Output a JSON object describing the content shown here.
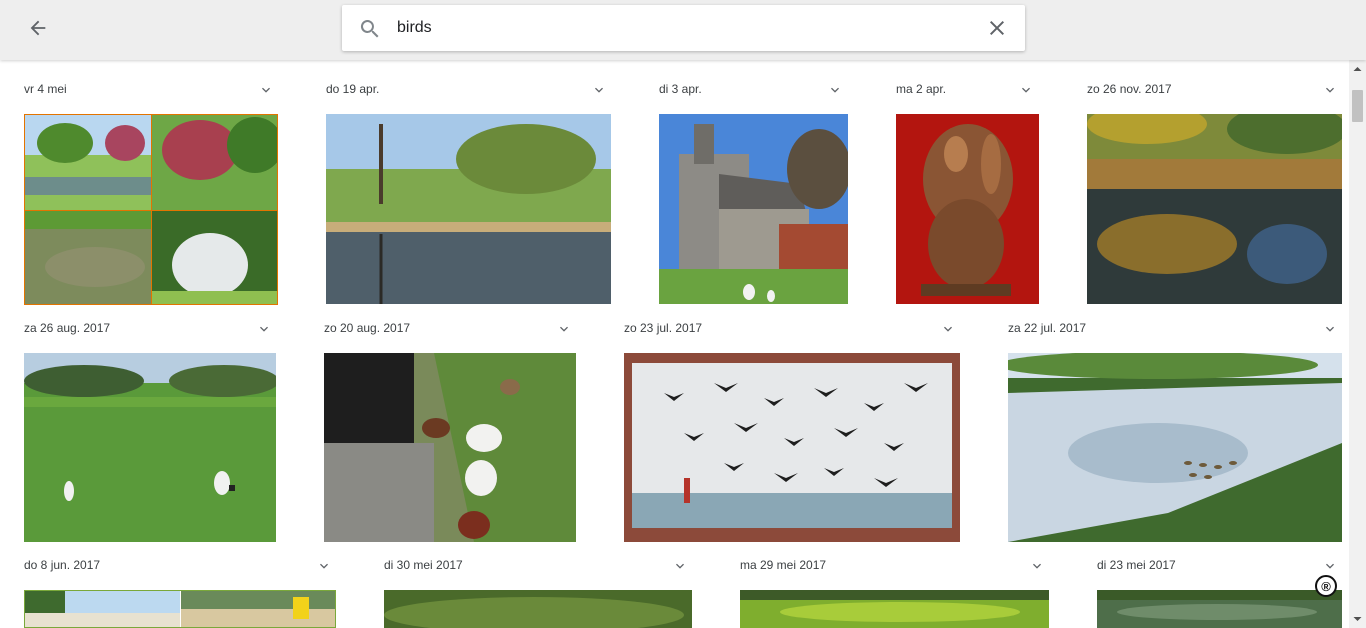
{
  "search": {
    "query": "birds"
  },
  "icons": {
    "back": "arrow-left-icon",
    "search": "search-icon",
    "clear": "close-icon",
    "group": "chevron-down-icon"
  },
  "groups": [
    {
      "date": "vr 4 mei"
    },
    {
      "date": "do 19 apr."
    },
    {
      "date": "di 3 apr."
    },
    {
      "date": "ma 2 apr."
    },
    {
      "date": "zo 26 nov. 2017"
    },
    {
      "date": "za 26 aug. 2017"
    },
    {
      "date": "zo 20 aug. 2017"
    },
    {
      "date": "zo 23 jul. 2017"
    },
    {
      "date": "za 22 jul. 2017"
    },
    {
      "date": "do 8 jun. 2017"
    },
    {
      "date": "di 30 mei 2017"
    },
    {
      "date": "ma 29 mei 2017"
    },
    {
      "date": "di 23 mei 2017"
    }
  ],
  "badge": {
    "text": "®"
  },
  "colors": {
    "topbar": "#eeeeee",
    "selected_border": "#e37400"
  }
}
